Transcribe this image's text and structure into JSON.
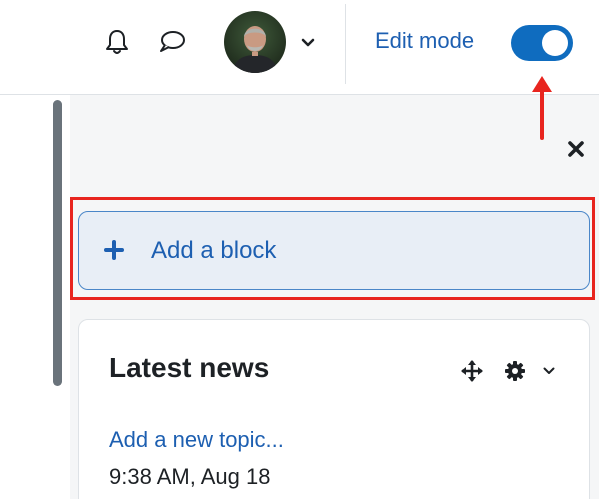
{
  "navbar": {
    "notifications_icon": "bell-icon",
    "messages_icon": "speech-bubble-icon",
    "user_menu_icon": "chevron-down-icon",
    "edit_mode_label": "Edit mode",
    "edit_mode_on": true
  },
  "drawer": {
    "close_icon": "close-icon",
    "add_block": {
      "label": "Add a block",
      "icon": "plus-icon"
    },
    "latest_news": {
      "title": "Latest news",
      "tool_icons": [
        "move-icon",
        "gear-icon",
        "chevron-down-icon"
      ],
      "link": "Add a new topic...",
      "date": "9:38 AM, Aug 18"
    }
  },
  "colors": {
    "link": "#1d5fb1",
    "toggle": "#0f6cbf",
    "annotation": "#e8251f",
    "drawer_bg": "#f5f6f7",
    "add_block_bg": "#e8eef6"
  }
}
